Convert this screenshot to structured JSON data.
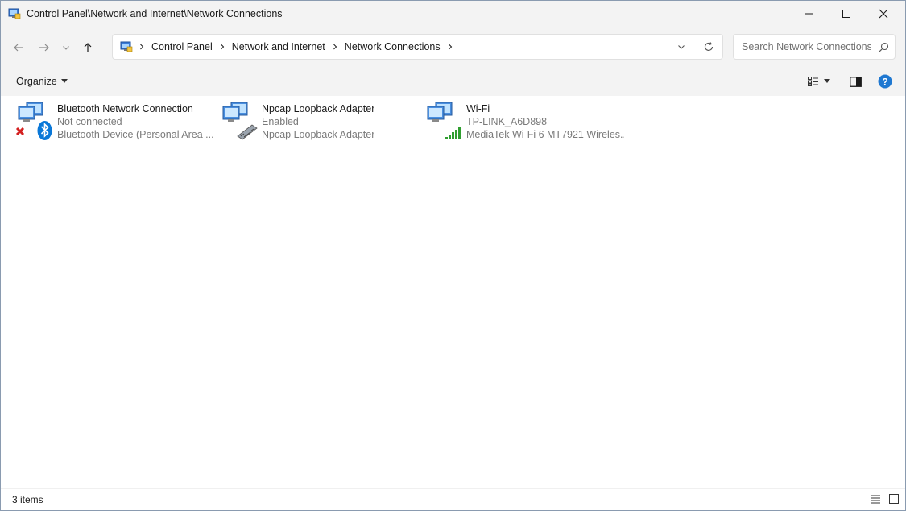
{
  "window": {
    "title": "Control Panel\\Network and Internet\\Network Connections"
  },
  "breadcrumb": {
    "items": [
      "Control Panel",
      "Network and Internet",
      "Network Connections"
    ]
  },
  "search": {
    "placeholder": "Search Network Connections"
  },
  "toolbar": {
    "organize_label": "Organize"
  },
  "connections": [
    {
      "name": "Bluetooth Network Connection",
      "status": "Not connected",
      "device": "Bluetooth Device (Personal Area ...",
      "icon": "bluetooth-network-icon"
    },
    {
      "name": "Npcap Loopback Adapter",
      "status": "Enabled",
      "device": "Npcap Loopback Adapter",
      "icon": "loopback-adapter-icon"
    },
    {
      "name": "Wi-Fi",
      "status": "TP-LINK_A6D898",
      "device": "MediaTek Wi-Fi 6 MT7921 Wireles...",
      "icon": "wifi-adapter-icon"
    }
  ],
  "status_bar": {
    "item_count": "3 items"
  },
  "colors": {
    "accent": "#0067c0",
    "help_blue": "#1f78d1",
    "error_red": "#d42020",
    "signal_green": "#2f9e2f"
  }
}
